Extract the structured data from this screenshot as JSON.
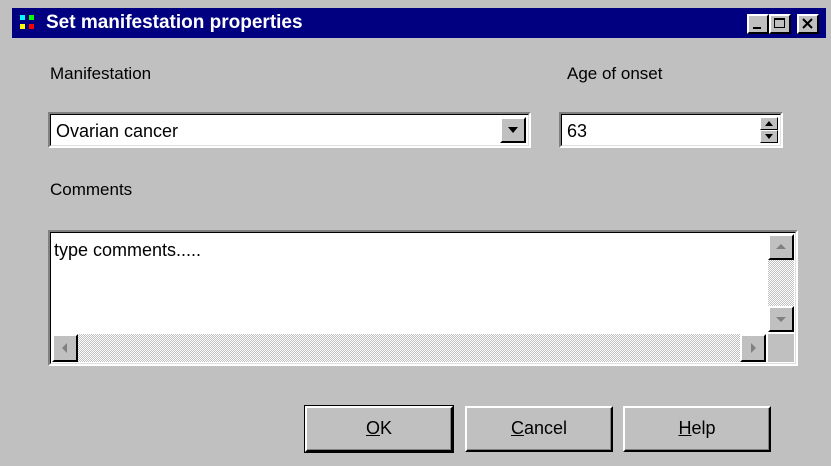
{
  "window": {
    "title": "Set manifestation properties",
    "buttons": {
      "minimize": "minimize",
      "maximize": "maximize",
      "close": "close"
    }
  },
  "form": {
    "manifestation_label": "Manifestation",
    "manifestation_value": "Ovarian cancer",
    "age_label": "Age of onset",
    "age_value": "63",
    "comments_label": "Comments",
    "comments_value": "type comments....."
  },
  "buttons": {
    "ok": {
      "mnemonic": "O",
      "rest": "K"
    },
    "cancel": {
      "mnemonic": "C",
      "rest": "ancel"
    },
    "help": {
      "mnemonic": "H",
      "rest": "elp"
    }
  },
  "colors": {
    "titlebar": "#000080",
    "face": "#c0c0c0",
    "icon_dots": [
      "#00ff00",
      "#ffff00",
      "#ff0000",
      "#00ffff"
    ]
  }
}
